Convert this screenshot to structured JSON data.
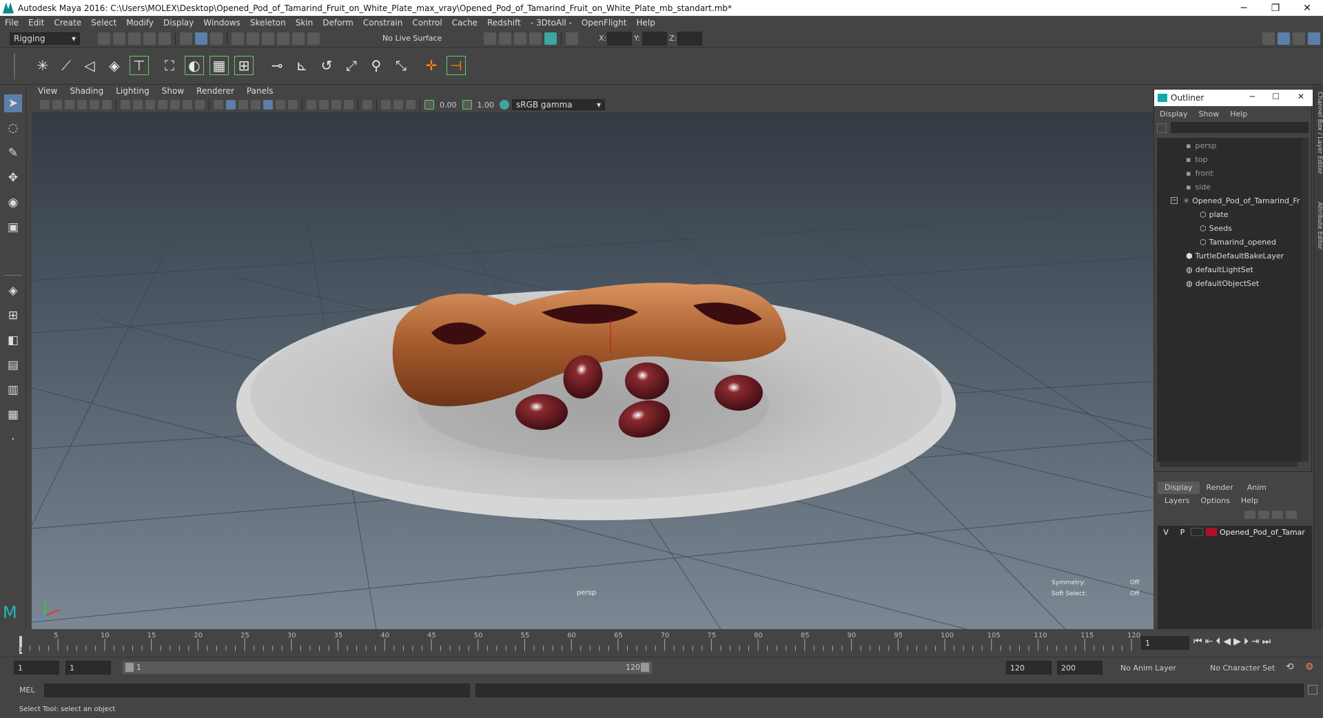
{
  "window": {
    "title": "Autodesk Maya 2016: C:\\Users\\MOLEX\\Desktop\\Opened_Pod_of_Tamarind_Fruit_on_White_Plate_max_vray\\Opened_Pod_of_Tamarind_Fruit_on_White_Plate_mb_standart.mb*",
    "minimize": "─",
    "restore": "❐",
    "close": "✕"
  },
  "menubar": [
    "File",
    "Edit",
    "Create",
    "Select",
    "Modify",
    "Display",
    "Windows",
    "Skeleton",
    "Skin",
    "Deform",
    "Constrain",
    "Control",
    "Cache",
    "Redshift",
    "- 3DtoAll -",
    "OpenFlight",
    "Help"
  ],
  "statusline": {
    "menuset": "Rigging",
    "live_surface": "No Live Surface",
    "x_label": "X:",
    "y_label": "Y:",
    "z_label": "Z:"
  },
  "viewport": {
    "menus": [
      "View",
      "Shading",
      "Lighting",
      "Show",
      "Renderer",
      "Panels"
    ],
    "near_value": "0.00",
    "far_value": "1.00",
    "color_space": "sRGB gamma",
    "camera_label": "persp",
    "symmetry_label": "Symmetry:",
    "symmetry_value": "Off",
    "soft_select_label": "Soft Select:",
    "soft_select_value": "Off"
  },
  "outliner": {
    "title": "Outliner",
    "menus": [
      "Display",
      "Show",
      "Help"
    ],
    "items": [
      {
        "label": "persp",
        "icon": "camera-icon",
        "dim": true
      },
      {
        "label": "top",
        "icon": "camera-icon",
        "dim": true
      },
      {
        "label": "front",
        "icon": "camera-icon",
        "dim": true
      },
      {
        "label": "side",
        "icon": "camera-icon",
        "dim": true
      },
      {
        "label": "Opened_Pod_of_Tamarind_Fr",
        "icon": "group-icon",
        "dim": false
      },
      {
        "label": "plate",
        "icon": "mesh-icon",
        "dim": false
      },
      {
        "label": "Seeds",
        "icon": "mesh-icon",
        "dim": false
      },
      {
        "label": "Tamarind_opened",
        "icon": "mesh-icon",
        "dim": false
      },
      {
        "label": "TurtleDefaultBakeLayer",
        "icon": "bake-layer-icon",
        "dim": false
      },
      {
        "label": "defaultLightSet",
        "icon": "set-icon",
        "dim": false
      },
      {
        "label": "defaultObjectSet",
        "icon": "set-icon",
        "dim": false
      }
    ]
  },
  "layers": {
    "tabs": [
      "Display",
      "Render",
      "Anim"
    ],
    "menus": [
      "Layers",
      "Options",
      "Help"
    ],
    "row": {
      "v": "V",
      "p": "P",
      "name": "Opened_Pod_of_Tamar",
      "color": "#b0102a"
    }
  },
  "timeline": {
    "ticks": [
      "5",
      "10",
      "15",
      "20",
      "25",
      "30",
      "35",
      "40",
      "45",
      "50",
      "55",
      "60",
      "65",
      "70",
      "75",
      "80",
      "85",
      "90",
      "95",
      "100",
      "105",
      "110",
      "115",
      "120"
    ],
    "start_marker": "1",
    "current_frame": "1"
  },
  "range": {
    "start": "1",
    "playback_start": "1",
    "slider_start": "1",
    "slider_end": "120",
    "playback_end": "120",
    "end": "200",
    "anim_layer": "No Anim Layer",
    "character_set": "No Character Set"
  },
  "mel": {
    "label": "MEL"
  },
  "help_line": "Select Tool: select an object",
  "side_tabs": {
    "channel_box": "Channel Box / Layer Editor",
    "attribute_editor": "Attribute Editor"
  }
}
